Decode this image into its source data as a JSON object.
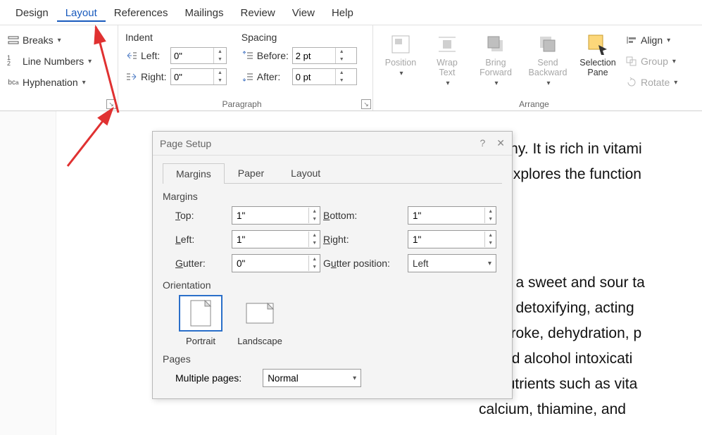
{
  "tabs": {
    "design": "Design",
    "layout": "Layout",
    "references": "References",
    "mailings": "Mailings",
    "review": "Review",
    "view": "View",
    "help": "Help"
  },
  "page_setup_group": {
    "breaks": "Breaks",
    "line_numbers": "Line Numbers",
    "hyphenation": "Hyphenation"
  },
  "paragraph_group": {
    "title": "Paragraph",
    "indent_hdr": "Indent",
    "spacing_hdr": "Spacing",
    "left_label": "Left:",
    "right_label": "Right:",
    "before_label": "Before:",
    "after_label": "After:",
    "left_val": "0\"",
    "right_val": "0\"",
    "before_val": "2 pt",
    "after_val": "0 pt"
  },
  "arrange_group": {
    "title": "Arrange",
    "position": "Position",
    "wrap_text": "Wrap\nText",
    "bring_forward": "Bring\nForward",
    "send_backward": "Send\nBackward",
    "selection_pane": "Selection\nPane",
    "align": "Align",
    "group": "Group",
    "rotate": "Rotate"
  },
  "doc": {
    "line1": "many. It is rich in vitami",
    "line2": "le explores the function",
    "line3": "r has a sweet and sour ta",
    "line4": "heat, detoxifying, acting",
    "line5": "eatstroke, dehydration, p",
    "line6": "e, and alcohol intoxicati",
    "line7": "ns nutrients such as vita",
    "line8": "calcium, thiamine, and"
  },
  "dialog": {
    "title": "Page Setup",
    "help": "?",
    "close": "✕",
    "tab_margins": "Margins",
    "tab_paper": "Paper",
    "tab_layout": "Layout",
    "margins_hdr": "Margins",
    "top_label": "Top:",
    "bottom_label": "Bottom:",
    "left_label": "Left:",
    "right_label": "Right:",
    "gutter_label": "Gutter:",
    "gutter_pos_label": "Gutter position:",
    "top_val": "1\"",
    "bottom_val": "1\"",
    "left_val": "1\"",
    "right_val": "1\"",
    "gutter_val": "0\"",
    "gutter_pos_val": "Left",
    "orientation_hdr": "Orientation",
    "portrait": "Portrait",
    "landscape": "Landscape",
    "pages_hdr": "Pages",
    "multi_pages_label": "Multiple pages:",
    "multi_pages_val": "Normal"
  }
}
